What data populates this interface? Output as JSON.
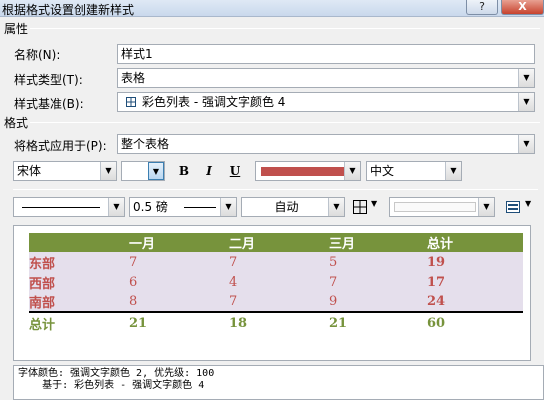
{
  "window": {
    "title": "根据格式设置创建新样式",
    "help_glyph": "?",
    "close_glyph": "X"
  },
  "properties": {
    "section_label": "属性",
    "name_label": "名称(N):",
    "name_value": "样式1",
    "type_label": "样式类型(T):",
    "type_value": "表格",
    "base_label": "样式基准(B):",
    "base_value": "彩色列表 - 强调文字颜色 4",
    "base_icon": "table-grid-icon"
  },
  "format": {
    "section_label": "格式",
    "apply_label": "将格式应用于(P):",
    "apply_value": "整个表格",
    "font_value": "宋体",
    "size_value": "",
    "bold_label": "B",
    "italic_label": "I",
    "underline_label": "U",
    "font_color": "#c0504d",
    "language_value": "中文",
    "line_width_value": "0.5 磅",
    "border_color_value": "自动",
    "border_icon": "borders-icon",
    "shading_value": "",
    "shading_icon": "shading-icon"
  },
  "preview": {
    "headers": [
      "",
      "一月",
      "二月",
      "三月",
      "总计"
    ],
    "rows": [
      {
        "label": "东部",
        "values": [
          "7",
          "7",
          "5"
        ],
        "total": "19"
      },
      {
        "label": "西部",
        "values": [
          "6",
          "4",
          "7"
        ],
        "total": "17"
      },
      {
        "label": "南部",
        "values": [
          "8",
          "7",
          "9"
        ],
        "total": "24"
      }
    ],
    "footer": {
      "label": "总计",
      "values": [
        "21",
        "18",
        "21"
      ],
      "total": "60"
    },
    "colors": {
      "header_bg": "#77933c",
      "band_bg": "#e5dfec",
      "accent_red": "#c0504d",
      "accent_green": "#77933c"
    }
  },
  "description": {
    "line1": "字体颜色: 强调文字颜色 2, 优先级: 100",
    "line2": "    基于: 彩色列表 - 强调文字颜色 4"
  }
}
